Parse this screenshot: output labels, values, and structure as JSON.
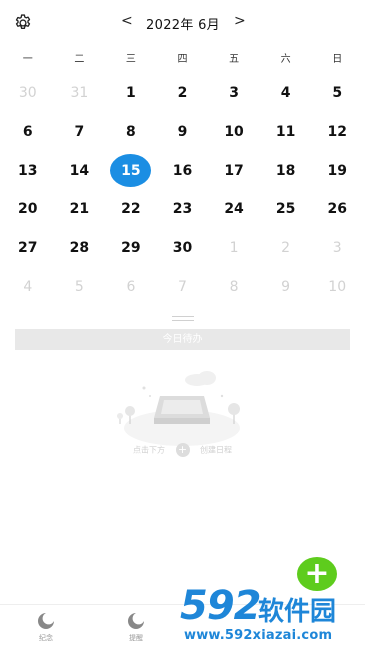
{
  "header": {
    "prev_arrow": "<",
    "next_arrow": ">",
    "month_title": "2022年 6月",
    "settings_icon": "gear-icon"
  },
  "weekdays": [
    "一",
    "二",
    "三",
    "四",
    "五",
    "六",
    "日"
  ],
  "days": [
    {
      "n": "30",
      "muted": true
    },
    {
      "n": "31",
      "muted": true
    },
    {
      "n": "1"
    },
    {
      "n": "2"
    },
    {
      "n": "3"
    },
    {
      "n": "4"
    },
    {
      "n": "5"
    },
    {
      "n": "6"
    },
    {
      "n": "7"
    },
    {
      "n": "8"
    },
    {
      "n": "9"
    },
    {
      "n": "10"
    },
    {
      "n": "11"
    },
    {
      "n": "12"
    },
    {
      "n": "13"
    },
    {
      "n": "14"
    },
    {
      "n": "15",
      "selected": true
    },
    {
      "n": "16"
    },
    {
      "n": "17"
    },
    {
      "n": "18"
    },
    {
      "n": "19"
    },
    {
      "n": "20"
    },
    {
      "n": "21"
    },
    {
      "n": "22"
    },
    {
      "n": "23"
    },
    {
      "n": "24"
    },
    {
      "n": "25"
    },
    {
      "n": "26"
    },
    {
      "n": "27"
    },
    {
      "n": "28"
    },
    {
      "n": "29"
    },
    {
      "n": "30"
    },
    {
      "n": "1",
      "muted": true
    },
    {
      "n": "2",
      "muted": true
    },
    {
      "n": "3",
      "muted": true
    },
    {
      "n": "4",
      "muted": true
    },
    {
      "n": "5",
      "muted": true
    },
    {
      "n": "6",
      "muted": true
    },
    {
      "n": "7",
      "muted": true
    },
    {
      "n": "8",
      "muted": true
    },
    {
      "n": "9",
      "muted": true
    },
    {
      "n": "10",
      "muted": true
    }
  ],
  "todo": {
    "section_title": "今日待办",
    "hint_left": "点击下方",
    "hint_plus": "+",
    "hint_right": "创建日程"
  },
  "fab": {
    "label": "+"
  },
  "tabs": [
    {
      "label": "纪念",
      "icon": "anniversary-icon"
    },
    {
      "label": "提醒",
      "icon": "reminder-icon"
    }
  ],
  "watermark": {
    "logo": "592",
    "name": "软件园",
    "url": "www.592xiazai.com"
  },
  "colors": {
    "selected": "#1b8ee3",
    "fab": "#5ecc1d",
    "muted_text": "#d2d2d2",
    "watermark": "#1e86d8"
  }
}
